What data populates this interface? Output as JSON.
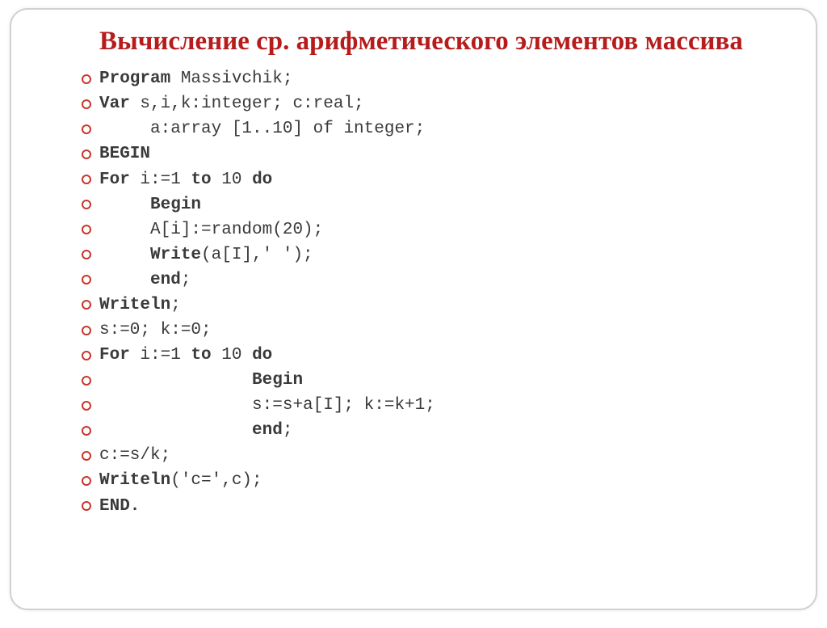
{
  "title": "Вычисление  ср. арифметического элементов массива",
  "lines": [
    {
      "pre": "",
      "kw": "Program",
      "post": " Massivchik;"
    },
    {
      "pre": "",
      "kw": "Var",
      "post": " s,i,k:integer; c:real;"
    },
    {
      "pre": "     a:array [1..10] of integer;",
      "kw": "",
      "post": ""
    },
    {
      "pre": "",
      "kw": "BEGIN",
      "post": ""
    },
    {
      "pre": "",
      "kw": "For",
      "mid": " i:=1 ",
      "kw2": "to",
      "mid2": " 10 ",
      "kw3": "do",
      "post": ""
    },
    {
      "pre": "     ",
      "kw": "Begin",
      "post": ""
    },
    {
      "pre": "     A[i]:=random(20);",
      "kw": "",
      "post": ""
    },
    {
      "pre": "     ",
      "kw": "Write",
      "post": "(a[I],' ');"
    },
    {
      "pre": "     ",
      "kw": "end",
      "post": ";"
    },
    {
      "pre": "",
      "kw": "Writeln",
      "post": ";"
    },
    {
      "pre": "s:=0; k:=0;",
      "kw": "",
      "post": ""
    },
    {
      "pre": "",
      "kw": "For",
      "mid": " i:=1 ",
      "kw2": "to",
      "mid2": " 10 ",
      "kw3": "do",
      "post": ""
    },
    {
      "pre": "               ",
      "kw": "Begin",
      "post": ""
    },
    {
      "pre": "               s:=s+a[I]; k:=k+1;",
      "kw": "",
      "post": ""
    },
    {
      "pre": "               ",
      "kw": "end",
      "post": ";"
    },
    {
      "pre": "c:=s/k;",
      "kw": "",
      "post": ""
    },
    {
      "pre": "",
      "kw": "Writeln",
      "post": "('c=',c);"
    },
    {
      "pre": "",
      "kw": "END.",
      "post": ""
    }
  ]
}
